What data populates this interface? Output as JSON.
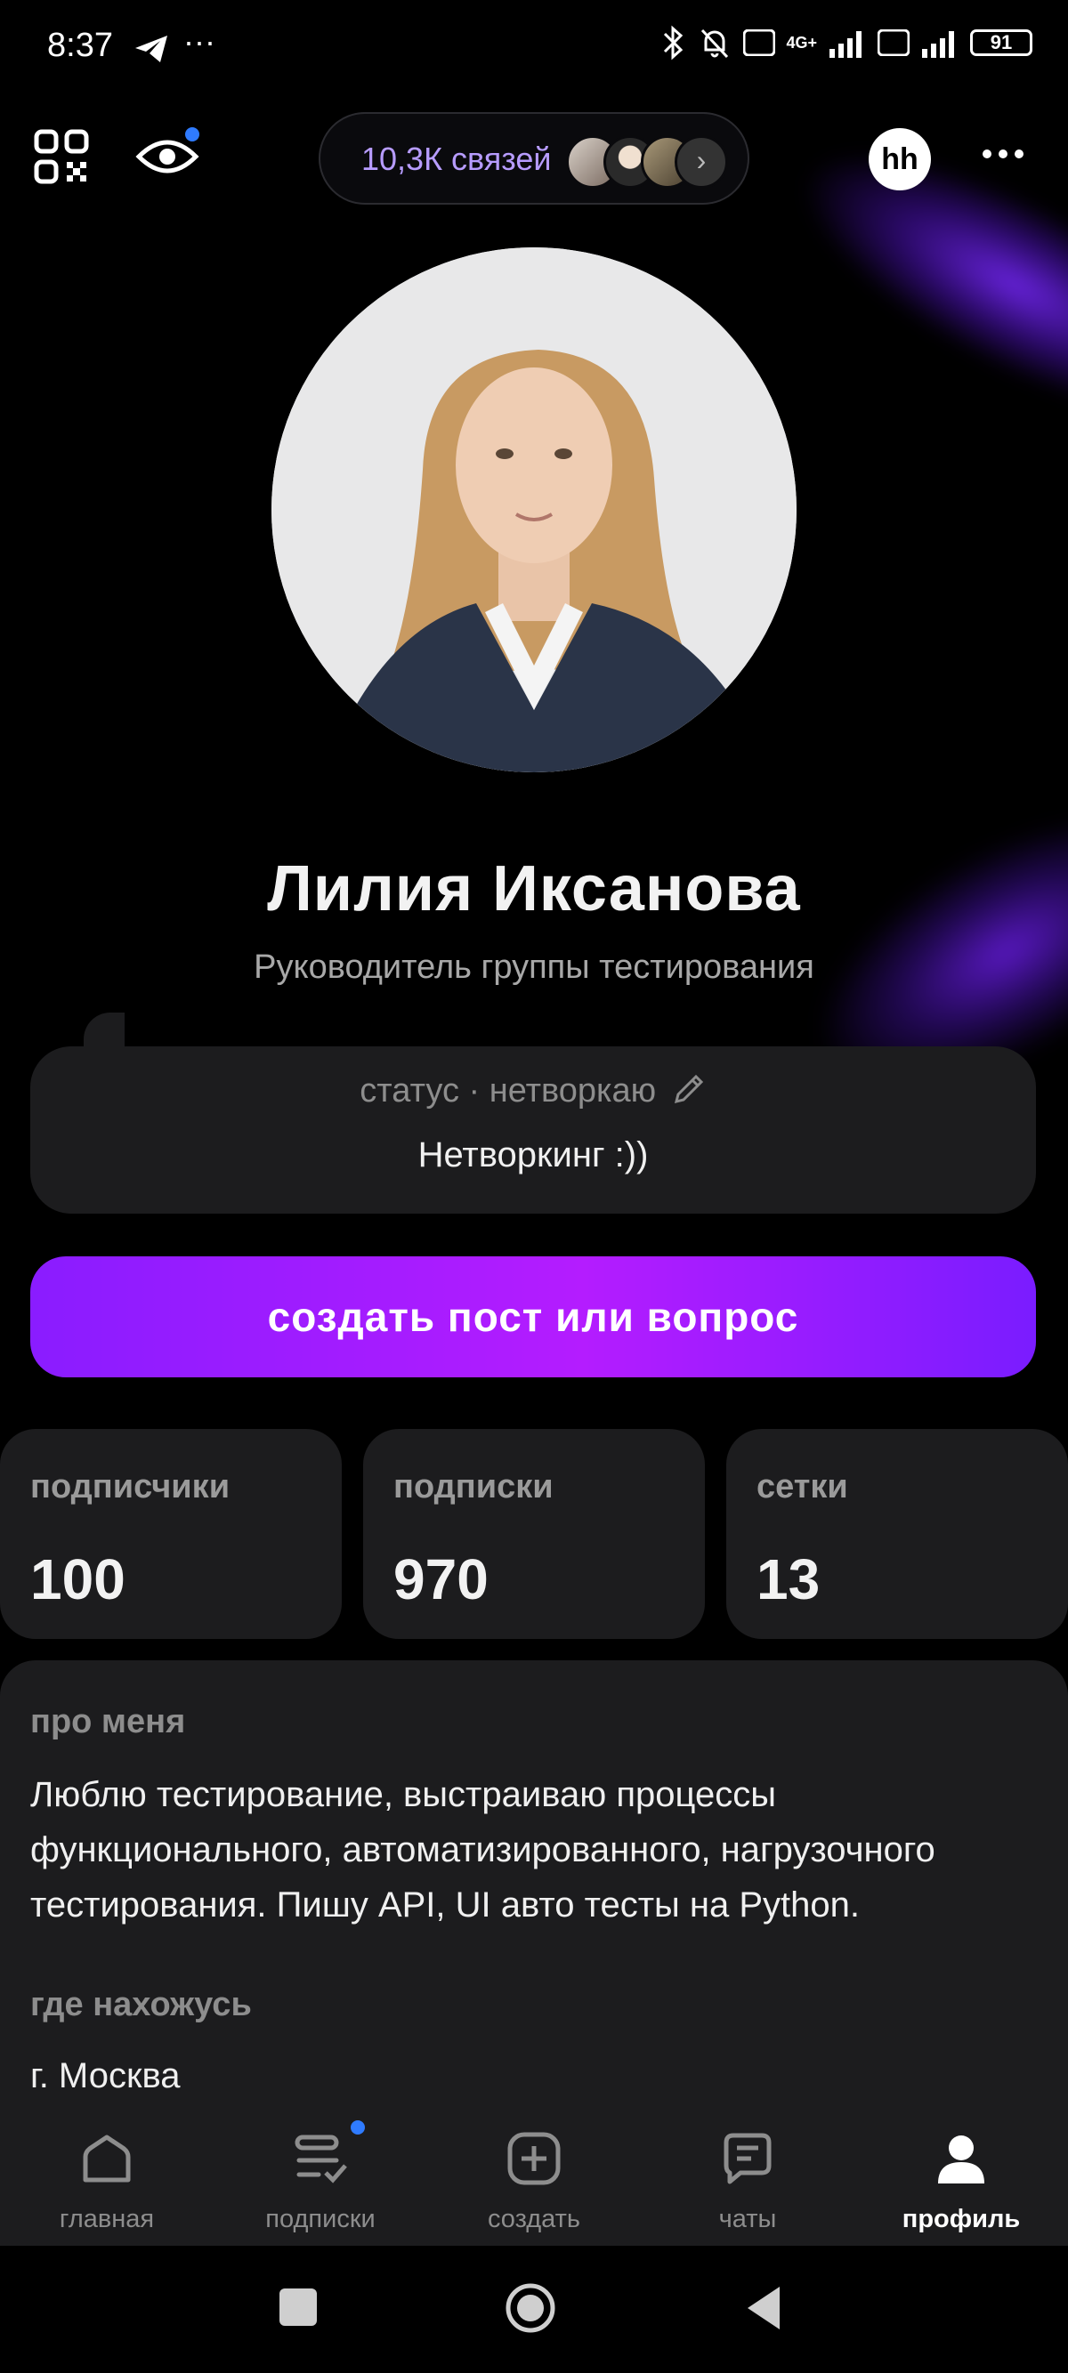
{
  "status_bar": {
    "time": "8:37",
    "extra": "···",
    "battery": "91",
    "network": "4G+"
  },
  "header": {
    "connections_label": "10,3К связей",
    "hh_logo": "hh"
  },
  "profile": {
    "name": "Лилия Иксанова",
    "job_title": "Руководитель группы тестирования"
  },
  "status": {
    "label": "статус · нетворкаю",
    "text": "Нетворкинг :))"
  },
  "cta": {
    "label": "создать пост или вопрос"
  },
  "stats": [
    {
      "label": "подписчики",
      "value": "100"
    },
    {
      "label": "подписки",
      "value": "970"
    },
    {
      "label": "сетки",
      "value": "13"
    }
  ],
  "about": {
    "heading": "про меня",
    "text": "Люблю тестирование, выстраиваю процессы функционального, автоматизированного, нагрузочного тестирования. Пишу API, UI авто тесты на Python.",
    "location_heading": "где нахожусь",
    "location": "г. Москва"
  },
  "nav": {
    "items": [
      {
        "label": "главная",
        "icon": "home-icon"
      },
      {
        "label": "подписки",
        "icon": "feed-icon"
      },
      {
        "label": "создать",
        "icon": "plus-icon"
      },
      {
        "label": "чаты",
        "icon": "chat-icon"
      },
      {
        "label": "профиль",
        "icon": "profile-icon",
        "active": true
      }
    ]
  },
  "colors": {
    "accent": "#8a1cff",
    "background": "#000000",
    "card": "#1c1c1e",
    "connections_text": "#b79cff"
  }
}
